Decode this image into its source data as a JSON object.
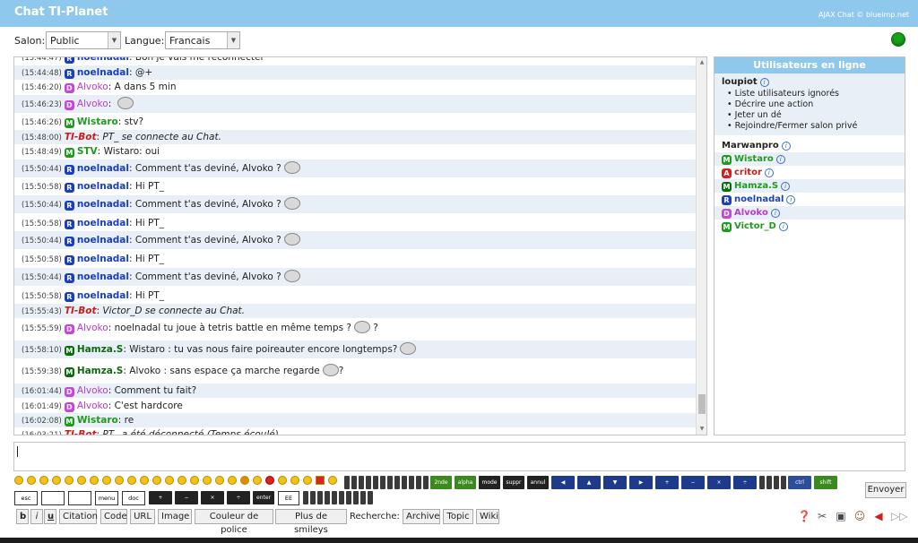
{
  "header": {
    "title": "Chat TI-Planet",
    "credit": "AJAX Chat © blueimp.net"
  },
  "settings": {
    "salon_label": "Salon:",
    "salon_value": "Public",
    "langue_label": "Langue:",
    "langue_value": "Francais"
  },
  "messages": [
    {
      "time": "(15:44:47)",
      "role": "R",
      "user": "noelnadal",
      "text": "Bon je vais me reconnecter",
      "partial": true
    },
    {
      "time": "(15:44:48)",
      "role": "R",
      "user": "noelnadal",
      "text": "@+"
    },
    {
      "time": "(15:46:20)",
      "role": "D",
      "user": "Alvoko",
      "text": "A dans 5 min"
    },
    {
      "time": "(15:46:23)",
      "role": "D",
      "user": "Alvoko",
      "text": "",
      "smiley": true
    },
    {
      "time": "(15:46:26)",
      "role": "M",
      "user": "Wistaro",
      "text": "stv?"
    },
    {
      "time": "(15:48:00)",
      "role": "bot",
      "user": "TI-Bot",
      "text": "PT_ se connecte au Chat."
    },
    {
      "time": "(15:48:49)",
      "role": "M",
      "user": "STV",
      "text": "Wistaro: oui"
    },
    {
      "time": "(15:50:44)",
      "role": "R",
      "user": "noelnadal",
      "text": "Comment t'as deviné, Alvoko ?",
      "smiley": true
    },
    {
      "time": "(15:50:58)",
      "role": "R",
      "user": "noelnadal",
      "text": "Hi PT_"
    },
    {
      "time": "(15:50:44)",
      "role": "R",
      "user": "noelnadal",
      "text": "Comment t'as deviné, Alvoko ?",
      "smiley": true
    },
    {
      "time": "(15:50:58)",
      "role": "R",
      "user": "noelnadal",
      "text": "Hi PT_"
    },
    {
      "time": "(15:50:44)",
      "role": "R",
      "user": "noelnadal",
      "text": "Comment t'as deviné, Alvoko ?",
      "smiley": true
    },
    {
      "time": "(15:50:58)",
      "role": "R",
      "user": "noelnadal",
      "text": "Hi PT_"
    },
    {
      "time": "(15:50:44)",
      "role": "R",
      "user": "noelnadal",
      "text": "Comment t'as deviné, Alvoko ?",
      "smiley": true
    },
    {
      "time": "(15:50:58)",
      "role": "R",
      "user": "noelnadal",
      "text": "Hi PT_"
    },
    {
      "time": "(15:55:43)",
      "role": "bot",
      "user": "TI-Bot",
      "text": "Victor_D se connecte au Chat."
    },
    {
      "time": "(15:55:59)",
      "role": "D",
      "user": "Alvoko",
      "text": "noelnadal tu joue à tetris battle en même temps ?",
      "smiley": true,
      "after": " ?"
    },
    {
      "time": "(15:58:10)",
      "role": "Hm",
      "user": "Hamza.S",
      "text": "Wistaro : tu vas nous faire poireauter encore longtemps?",
      "smiley": true
    },
    {
      "time": "(15:59:38)",
      "role": "Hm",
      "user": "Hamza.S",
      "text": "Alvoko : sans espace ça marche regarde",
      "smiley": true,
      "after": "?"
    },
    {
      "time": "(16:01:44)",
      "role": "D",
      "user": "Alvoko",
      "text": "Comment tu fait?"
    },
    {
      "time": "(16:01:49)",
      "role": "D",
      "user": "Alvoko",
      "text": "C'est hardcore"
    },
    {
      "time": "(16:02:08)",
      "role": "M",
      "user": "Wistaro",
      "text": "re"
    },
    {
      "time": "(16:03:21)",
      "role": "bot",
      "user": "TI-Bot",
      "text": "PT_ a été déconnecté (Temps écoulé).",
      "partial": true
    }
  ],
  "online": {
    "title": "Utilisateurs en ligne",
    "self": "loupiot",
    "menu": [
      "Liste utilisateurs ignorés",
      "Décrire une action",
      "Jeter un dé",
      "Rejoindre/Fermer salon privé"
    ],
    "users": [
      {
        "role": "",
        "name": "Marwanpro"
      },
      {
        "role": "M",
        "name": "Wistaro"
      },
      {
        "role": "A",
        "name": "critor"
      },
      {
        "role": "M",
        "name": "Hamza.S"
      },
      {
        "role": "R",
        "name": "noelnadal"
      },
      {
        "role": "D",
        "name": "Alvoko"
      },
      {
        "role": "M",
        "name": "Victor_D"
      }
    ]
  },
  "keys": [
    "2nde 2ND",
    "alpha",
    "mode",
    "suppr DEL",
    "annul CLEAR",
    "ctrl",
    "shift",
    "esc",
    "tab",
    "menu",
    "doc",
    "enter",
    "EE"
  ],
  "send_label": "Envoyer",
  "toolbar": {
    "bold": "b",
    "italic": "i",
    "underline": "u",
    "citation": "Citation",
    "code": "Code",
    "url": "URL",
    "image": "Image",
    "color": "Couleur de police",
    "smileys": "Plus de smileys",
    "search_label": "Recherche:",
    "archive": "Archive",
    "topic": "Topic",
    "wiki": "Wiki"
  },
  "colors": {
    "header": "#8ec8ec",
    "row_alt": "#e8eff6",
    "status_online": "#17a31a"
  }
}
